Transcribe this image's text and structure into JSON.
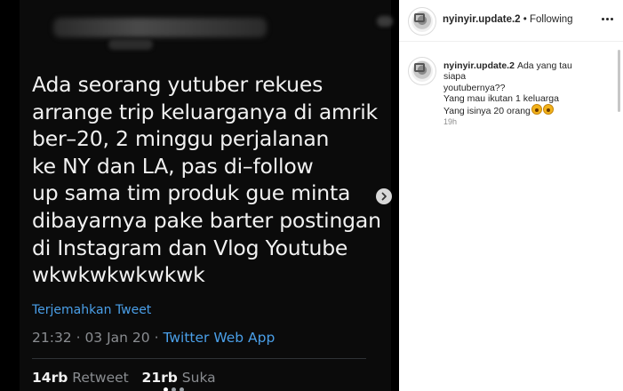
{
  "post": {
    "tweet": {
      "text": "Ada seorang yutuber rekues\narrange trip keluarganya di amrik\nber–20, 2 minggu perjalanan\nke NY dan LA, pas di–follow\nup sama tim produk gue minta\ndibayarnya pake barter postingan\ndi Instagram dan Vlog Youtube\nwkwkwkwkwkwk",
      "translate_label": "Terjemahkan Tweet",
      "time": "21:32 · 03 Jan 20 · ",
      "app": "Twitter Web App",
      "retweet_count": "14rb",
      "retweet_label": "Retweet",
      "like_count": "21rb",
      "like_label": "Suka"
    },
    "carousel": {
      "count": 3,
      "active_index": 0,
      "next_icon": "chevron-right-icon"
    }
  },
  "header": {
    "username": "nyinyir.update.2",
    "separator": " • ",
    "follow_status": "Following",
    "more_icon": "more-icon"
  },
  "caption": {
    "username": "nyinyir.update.2",
    "line1": "Ada yang tau siapa",
    "line2": "youtubernya??",
    "line3": "Yang mau ikutan 1 keluarga",
    "line4": "Yang isinya 20 orang",
    "emoji": "face-screaming-in-fear-emoji",
    "time": "19h"
  }
}
